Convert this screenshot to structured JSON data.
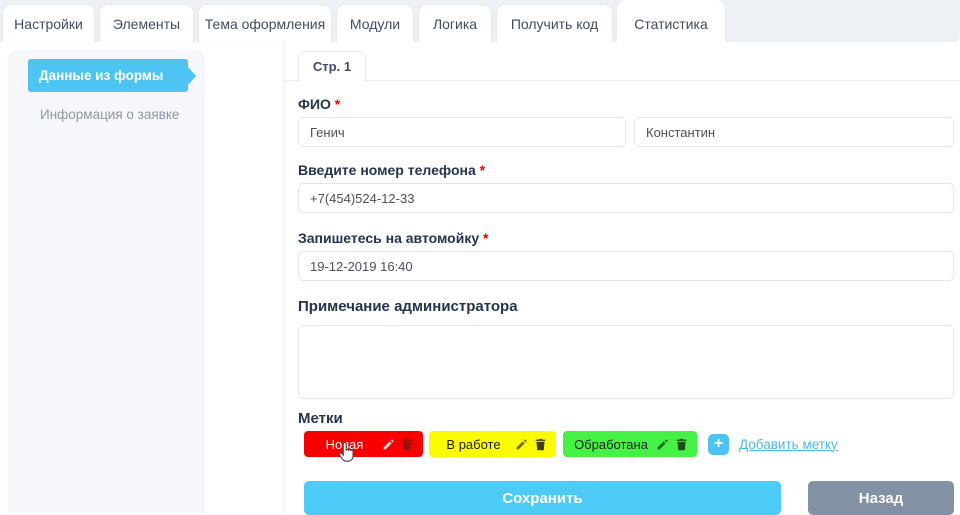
{
  "header_tabs": {
    "items": [
      {
        "label": "Настройки",
        "active": false
      },
      {
        "label": "Элементы",
        "active": false
      },
      {
        "label": "Тема оформления",
        "active": false
      },
      {
        "label": "Модули",
        "active": false
      },
      {
        "label": "Логика",
        "active": false
      },
      {
        "label": "Получить код",
        "active": false
      },
      {
        "label": "Статистика",
        "active": true
      }
    ]
  },
  "sidebar": {
    "items": [
      {
        "label": "Данные из формы",
        "active": true
      },
      {
        "label": "Информация о заявке",
        "active": false
      }
    ]
  },
  "main": {
    "page_tab": {
      "label": "Стр. 1"
    },
    "required_marker": "*",
    "fields": {
      "fio": {
        "label": "ФИО",
        "required": true,
        "first_value": "Генич",
        "second_value": "Константин"
      },
      "phone": {
        "label": "Введите номер телефона",
        "required": true,
        "value": "+7(454)524-12-33"
      },
      "carwash": {
        "label": "Запишетесь на автомойку",
        "required": true,
        "value": "19-12-2019 16:40"
      },
      "admin_note": {
        "label": "Примечание администратора",
        "value": ""
      }
    },
    "tags_section": {
      "title": "Метки",
      "tags": [
        {
          "label": "Новая",
          "bg": "#f90000",
          "fg": "#ffffff",
          "edit_icon_color": "#ffd6d6",
          "delete_icon_color": "#991111"
        },
        {
          "label": "В работе",
          "bg": "#fbfb00",
          "fg": "#202020",
          "edit_icon_color": "#70700f",
          "delete_icon_color": "#3e3e0e"
        },
        {
          "label": "Обработана",
          "bg": "#46f146",
          "fg": "#202020",
          "edit_icon_color": "#1d6b1d",
          "delete_icon_color": "#174f17"
        }
      ],
      "add_button_label": "+",
      "add_link_label": "Добавить метку"
    },
    "actions": {
      "save_label": "Сохранить",
      "back_label": "Назад"
    }
  },
  "colors": {
    "tab_bar_bg": "#edf0f4",
    "accent_blue": "#4ec4f2",
    "save_button": "#4bcbf6",
    "back_button": "#8391a5",
    "required_red": "#f30000",
    "link_blue": "#4fb8e9",
    "sidebar_bg": "#f5f7fa"
  }
}
